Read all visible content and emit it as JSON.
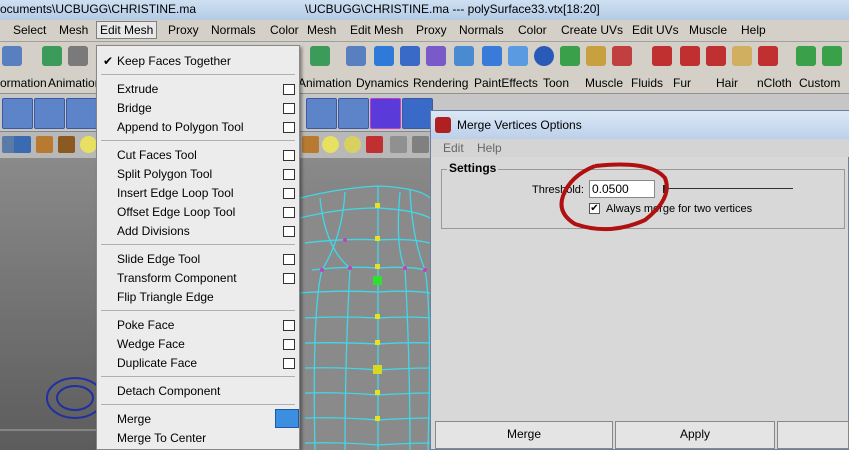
{
  "title_bar": {
    "left_text": "ocuments\\UCBUGG\\CHRISTINE.ma",
    "right_text": "\\UCBUGG\\CHRISTINE.ma  ---  polySurface33.vtx[18:20]"
  },
  "menubar": {
    "items": [
      "Select",
      "Mesh",
      "Edit Mesh",
      "Proxy",
      "Normals",
      "Color",
      "Mesh",
      "Edit Mesh",
      "Proxy",
      "Normals",
      "Color",
      "Create UVs",
      "Edit UVs",
      "Muscle",
      "Help"
    ]
  },
  "shelf_tabs": [
    "ormation",
    "Animation",
    "Animation",
    "Dynamics",
    "Rendering",
    "PaintEffects",
    "Toon",
    "Muscle",
    "Fluids",
    "Fur",
    "Hair",
    "nCloth",
    "Custom"
  ],
  "dropdown": {
    "checked_item": "Keep Faces Together",
    "groups": [
      [
        {
          "label": "Extrude",
          "box": true
        },
        {
          "label": "Bridge",
          "box": true
        },
        {
          "label": "Append to Polygon Tool",
          "box": true
        }
      ],
      [
        {
          "label": "Cut Faces Tool",
          "box": true
        },
        {
          "label": "Split Polygon Tool",
          "box": true
        },
        {
          "label": "Insert Edge Loop Tool",
          "box": true
        },
        {
          "label": "Offset Edge Loop Tool",
          "box": true
        },
        {
          "label": "Add Divisions",
          "box": true
        }
      ],
      [
        {
          "label": "Slide Edge Tool",
          "box": true
        },
        {
          "label": "Transform Component",
          "box": true
        },
        {
          "label": "Flip Triangle Edge",
          "box": false
        }
      ],
      [
        {
          "label": "Poke Face",
          "box": true
        },
        {
          "label": "Wedge Face",
          "box": true
        },
        {
          "label": "Duplicate Face",
          "box": true
        }
      ],
      [
        {
          "label": "Detach Component",
          "box": false
        }
      ],
      [
        {
          "label": "Merge",
          "box": true,
          "highlight": true
        },
        {
          "label": "Merge To Center",
          "box": false
        }
      ]
    ]
  },
  "dialog": {
    "title": "Merge Vertices Options",
    "menu": [
      "Edit",
      "Help"
    ],
    "section": "Settings",
    "threshold_label": "Threshold:",
    "threshold_value": "0.0500",
    "checkbox_label": "Always merge for two vertices",
    "checkbox_checked": true,
    "buttons": [
      "Merge",
      "Apply"
    ]
  },
  "colors": {
    "annotation_circle": "#b01010",
    "menu_highlight": "#3b8ee0",
    "wireframe": "#40d8e8"
  }
}
